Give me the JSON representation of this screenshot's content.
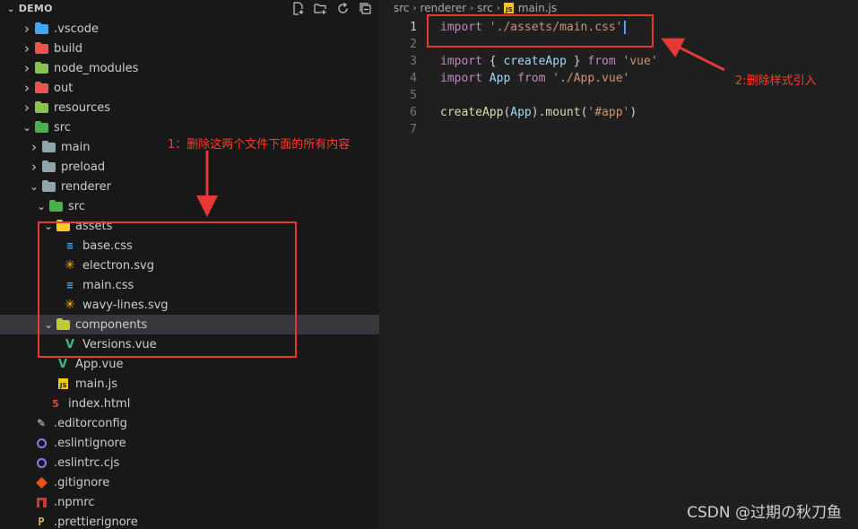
{
  "explorer": {
    "title": "DEMO",
    "actions": [
      "new-file-icon",
      "new-folder-icon",
      "refresh-icon",
      "collapse-all-icon"
    ],
    "items": [
      {
        "label": ".vscode",
        "depth": 0,
        "kind": "folder",
        "color": "#42a5f5",
        "expanded": false
      },
      {
        "label": "build",
        "depth": 0,
        "kind": "folder",
        "color": "#ef5350",
        "expanded": false
      },
      {
        "label": "node_modules",
        "depth": 0,
        "kind": "folder",
        "color": "#8bc34a",
        "expanded": false
      },
      {
        "label": "out",
        "depth": 0,
        "kind": "folder",
        "color": "#ef5350",
        "expanded": false
      },
      {
        "label": "resources",
        "depth": 0,
        "kind": "folder",
        "color": "#8bc34a",
        "expanded": false
      },
      {
        "label": "src",
        "depth": 0,
        "kind": "folder-open",
        "color": "#4caf50",
        "expanded": true
      },
      {
        "label": "main",
        "depth": 1,
        "kind": "folder",
        "color": "#90a4ae",
        "expanded": false
      },
      {
        "label": "preload",
        "depth": 1,
        "kind": "folder",
        "color": "#90a4ae",
        "expanded": false
      },
      {
        "label": "renderer",
        "depth": 1,
        "kind": "folder-open",
        "color": "#90a4ae",
        "expanded": true
      },
      {
        "label": "src",
        "depth": 2,
        "kind": "folder-open",
        "color": "#4caf50",
        "expanded": true
      },
      {
        "label": "assets",
        "depth": 3,
        "kind": "folder-open",
        "color": "#ffca28",
        "expanded": true
      },
      {
        "label": "base.css",
        "depth": 4,
        "kind": "css"
      },
      {
        "label": "electron.svg",
        "depth": 4,
        "kind": "svg"
      },
      {
        "label": "main.css",
        "depth": 4,
        "kind": "css"
      },
      {
        "label": "wavy-lines.svg",
        "depth": 4,
        "kind": "svg"
      },
      {
        "label": "components",
        "depth": 3,
        "kind": "folder-open",
        "color": "#c0ca33",
        "expanded": true,
        "selected": true
      },
      {
        "label": "Versions.vue",
        "depth": 4,
        "kind": "vue"
      },
      {
        "label": "App.vue",
        "depth": 3,
        "kind": "vue"
      },
      {
        "label": "main.js",
        "depth": 3,
        "kind": "js"
      },
      {
        "label": "index.html",
        "depth": 2,
        "kind": "html"
      },
      {
        "label": ".editorconfig",
        "depth": 0,
        "kind": "cfg"
      },
      {
        "label": ".eslintignore",
        "depth": 0,
        "kind": "eslint"
      },
      {
        "label": ".eslintrc.cjs",
        "depth": 0,
        "kind": "eslint"
      },
      {
        "label": ".gitignore",
        "depth": 0,
        "kind": "git"
      },
      {
        "label": ".npmrc",
        "depth": 0,
        "kind": "npm"
      },
      {
        "label": ".prettierignore",
        "depth": 0,
        "kind": "prettier"
      }
    ]
  },
  "breadcrumb": [
    "src",
    "renderer",
    "src",
    "main.js"
  ],
  "code": {
    "lines": [
      {
        "n": "1",
        "tokens": [
          [
            "kw",
            "import"
          ],
          [
            "punc",
            " "
          ],
          [
            "str",
            "'./assets/main.css'"
          ]
        ]
      },
      {
        "n": "2",
        "tokens": []
      },
      {
        "n": "3",
        "tokens": [
          [
            "kw",
            "import"
          ],
          [
            "punc",
            " { "
          ],
          [
            "ident",
            "createApp"
          ],
          [
            "punc",
            " } "
          ],
          [
            "kw",
            "from"
          ],
          [
            "punc",
            " "
          ],
          [
            "str",
            "'vue'"
          ]
        ]
      },
      {
        "n": "4",
        "tokens": [
          [
            "kw",
            "import"
          ],
          [
            "punc",
            " "
          ],
          [
            "ident",
            "App"
          ],
          [
            "punc",
            " "
          ],
          [
            "kw",
            "from"
          ],
          [
            "punc",
            " "
          ],
          [
            "str",
            "'./App.vue'"
          ]
        ]
      },
      {
        "n": "5",
        "tokens": []
      },
      {
        "n": "6",
        "tokens": [
          [
            "fn",
            "createApp"
          ],
          [
            "punc",
            "("
          ],
          [
            "ident",
            "App"
          ],
          [
            "punc",
            ")."
          ],
          [
            "fn",
            "mount"
          ],
          [
            "punc",
            "("
          ],
          [
            "str",
            "'#app'"
          ],
          [
            "punc",
            ")"
          ]
        ]
      },
      {
        "n": "7",
        "tokens": []
      }
    ]
  },
  "annotations": {
    "note1": "1：删除这两个文件下面的所有内容",
    "note2": "2:删除样式引入",
    "color": "#e53935"
  },
  "watermark": "CSDN @过期の秋刀鱼"
}
